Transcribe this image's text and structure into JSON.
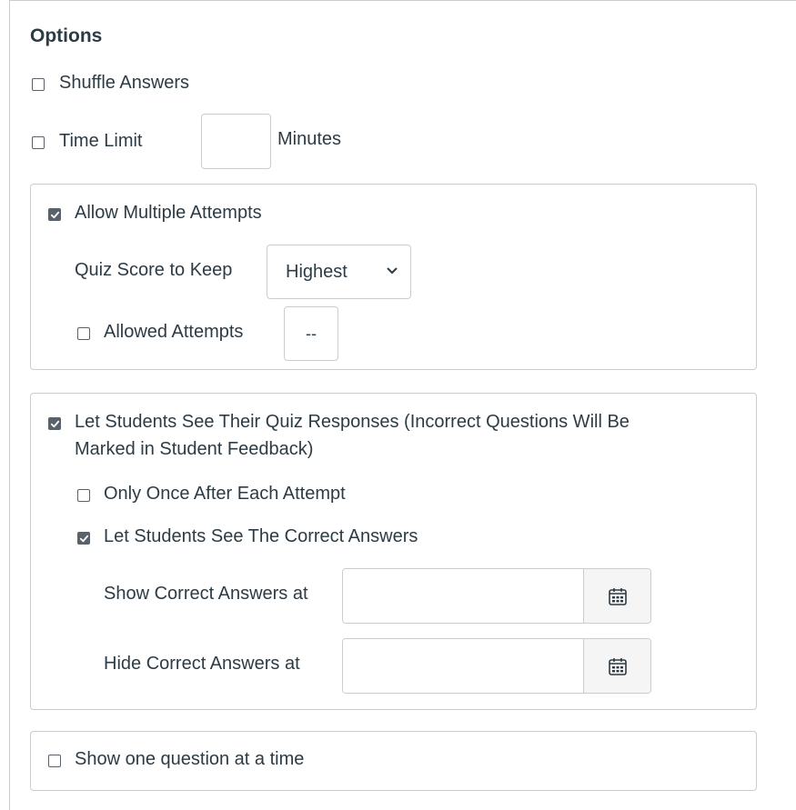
{
  "options": {
    "heading": "Options",
    "shuffle_answers": {
      "label": "Shuffle Answers",
      "checked": false
    },
    "time_limit": {
      "label": "Time Limit",
      "value": "",
      "unit": "Minutes",
      "checked": false
    },
    "multiple_attempts": {
      "label": "Allow Multiple Attempts",
      "checked": true,
      "score_to_keep_label": "Quiz Score to Keep",
      "score_to_keep_value": "Highest",
      "allowed_attempts": {
        "label": "Allowed Attempts",
        "value": "--",
        "checked": false
      }
    },
    "see_responses": {
      "label_line1": "Let Students See Their Quiz Responses (Incorrect Questions Will Be",
      "label_line2": "Marked in Student Feedback)",
      "checked": true,
      "only_once": {
        "label": "Only Once After Each Attempt",
        "checked": false
      },
      "see_correct": {
        "label": "Let Students See The Correct Answers",
        "checked": true
      },
      "show_correct_at": {
        "label": "Show Correct Answers at",
        "value": ""
      },
      "hide_correct_at": {
        "label": "Hide Correct Answers at",
        "value": ""
      }
    },
    "one_question": {
      "label": "Show one question at a time",
      "checked": false
    }
  },
  "icons": {
    "check": "check-icon",
    "chevron": "chevron-down-icon",
    "calendar": "calendar-icon"
  }
}
